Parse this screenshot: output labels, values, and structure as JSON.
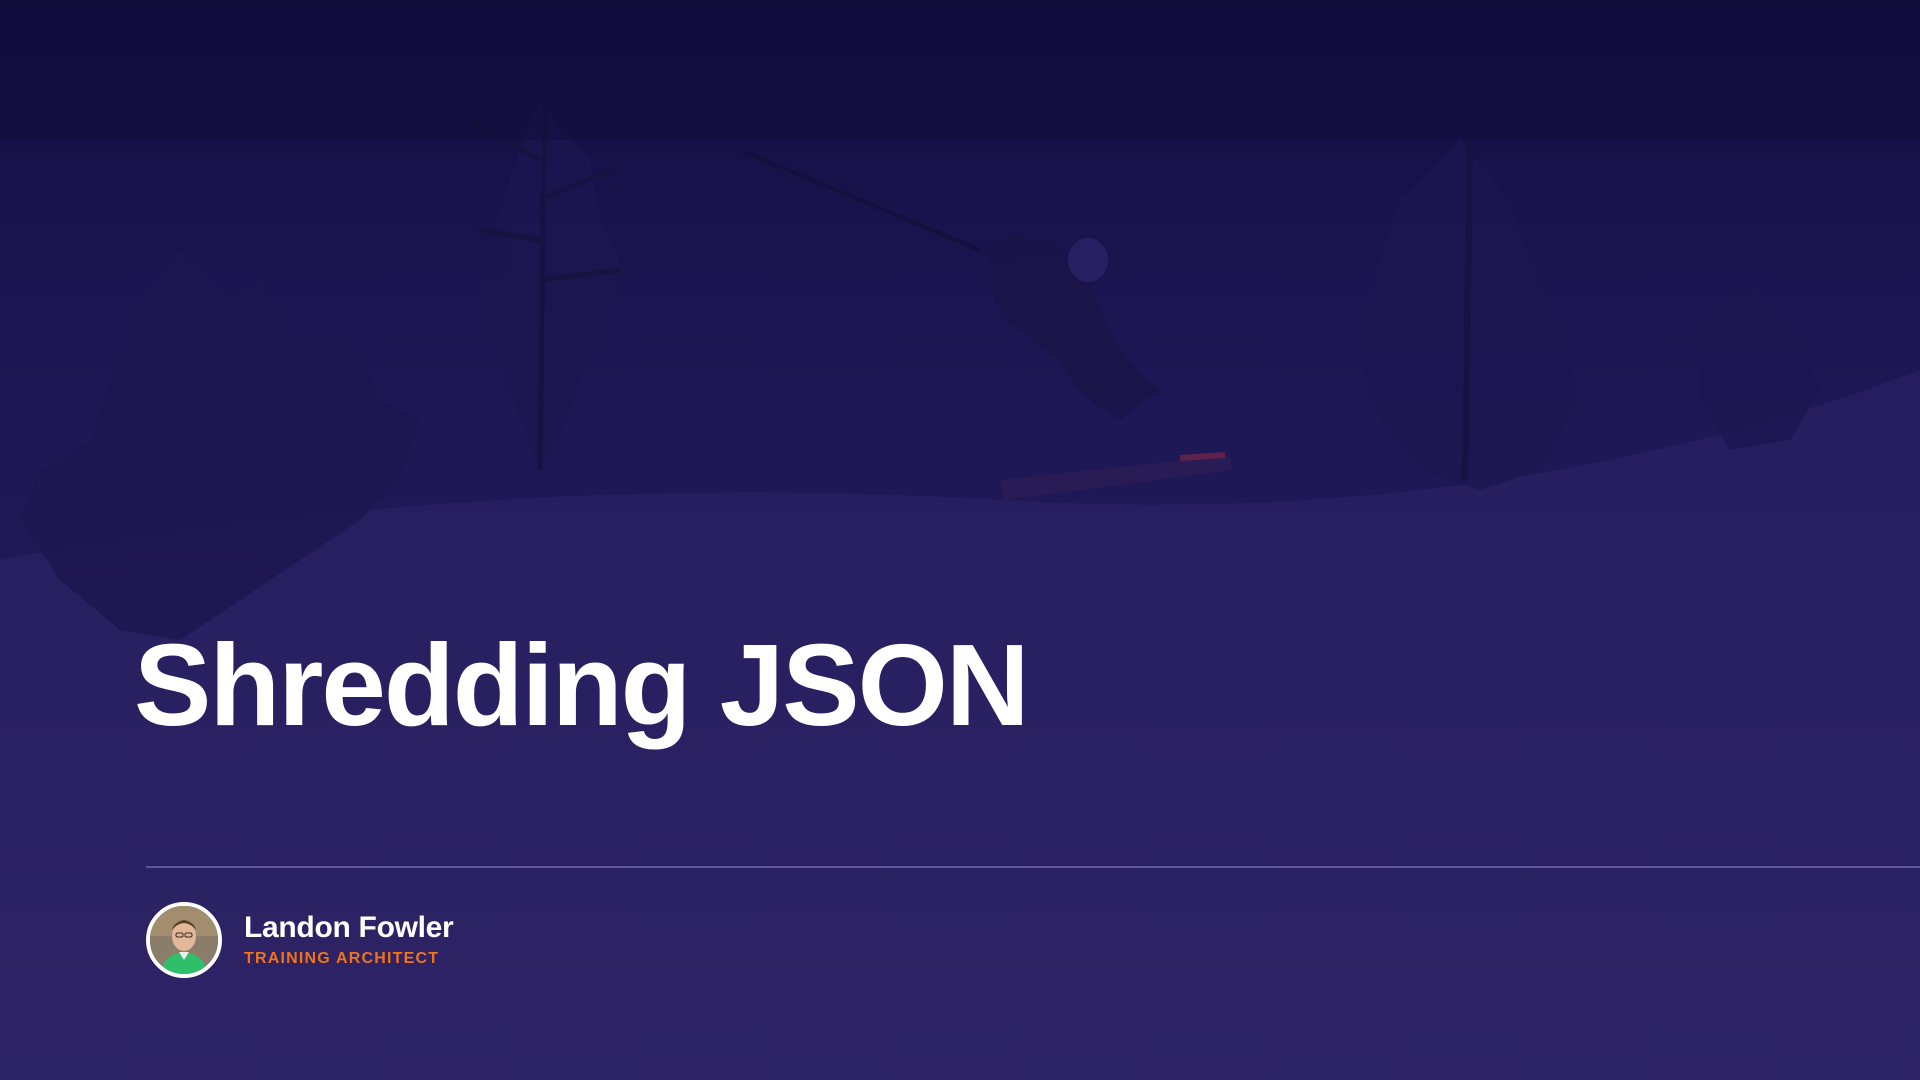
{
  "slide": {
    "title": "Shredding JSON",
    "author": {
      "name": "Landon Fowler",
      "role": "TRAINING ARCHITECT"
    }
  },
  "colors": {
    "background_top": "#120e40",
    "background_bottom": "#2a2063",
    "title": "#ffffff",
    "role_accent": "#f0731c",
    "divider": "#8c82c8"
  },
  "icons": {
    "avatar": "presenter-photo",
    "background": "skier-in-snowy-forest-photo"
  }
}
